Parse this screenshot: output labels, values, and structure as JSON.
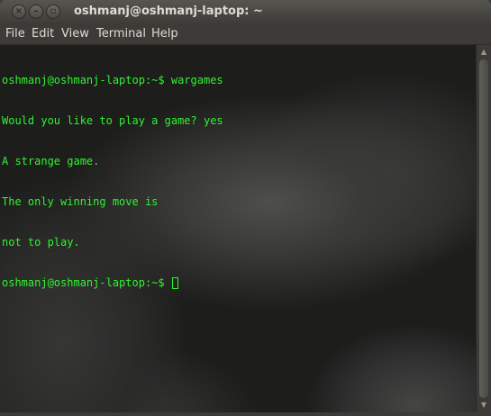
{
  "window": {
    "title": "oshmanj@oshmanj-laptop: ~"
  },
  "window_buttons": [
    {
      "name": "close",
      "glyph": "×"
    },
    {
      "name": "minimize",
      "glyph": "–"
    },
    {
      "name": "maximize",
      "glyph": "▫"
    }
  ],
  "menu": {
    "items": [
      "File",
      "Edit",
      "View",
      "Terminal",
      "Help"
    ]
  },
  "terminal": {
    "text_color": "#2ef52e",
    "lines": [
      "oshmanj@oshmanj-laptop:~$ wargames",
      "Would you like to play a game? yes",
      "A strange game.",
      "The only winning move is",
      "not to play."
    ],
    "prompt": "oshmanj@oshmanj-laptop:~$ "
  },
  "scrollbar": {
    "position_fraction": 1.0,
    "visible_fraction": 1.0
  }
}
